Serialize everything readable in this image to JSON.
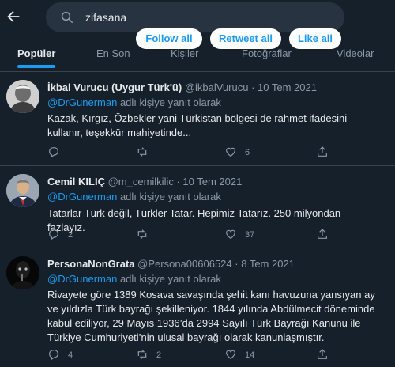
{
  "search": {
    "query": "zifasana"
  },
  "bulk_actions": {
    "follow_all": "Follow all",
    "retweet_all": "Retweet all",
    "like_all": "Like all"
  },
  "tabs": [
    {
      "label": "Popüler"
    },
    {
      "label": "En Son"
    },
    {
      "label": "Kişiler"
    },
    {
      "label": "Fotoğraflar"
    },
    {
      "label": "Videolar"
    }
  ],
  "tweets": [
    {
      "name": "İkbal Vurucu (Uygur Türk'ü)",
      "handle": "@ikbalVurucu",
      "date": "· 10 Tem 2021",
      "reply_mention": "@DrGunerman",
      "reply_suffix": " adlı kişiye yanıt olarak",
      "text": "Kazak, Kırgız, Özbekler yani Türkistan bölgesi de rahmet ifadesini kullanır, teşekkür mahiyetinde...",
      "replies": "",
      "retweets": "",
      "likes": "6"
    },
    {
      "name": "Cemil KILIÇ",
      "handle": "@m_cemilkilic",
      "date": "· 10 Tem 2021",
      "reply_mention": "@DrGunerman",
      "reply_suffix": " adlı kişiye yanıt olarak",
      "text": "Tatarlar Türk değil, Türkler Tatar. Hepimiz Tatarız. 250 milyondan fazlayız.",
      "replies": "2",
      "retweets": "",
      "likes": "37"
    },
    {
      "name": "PersonaNonGrata",
      "handle": "@Persona00606524",
      "date": "· 8 Tem 2021",
      "reply_mention": "@DrGunerman",
      "reply_suffix": " adlı kişiye yanıt olarak",
      "text": "Rivayete göre 1389 Kosava savaşında şehit kanı havuzuna yansıyan ay ve yıldızla Türk bayrağı şekilleniyor. 1844 yılında Abdülmecit döneminde kabul ediliyor, 29 Mayıs 1936’da 2994 Sayılı Türk Bayrağı Kanunu ile Türkiye Cumhuriyeti’nin ulusal bayrağı olarak kanunlaşmıştır.",
      "replies": "4",
      "retweets": "2",
      "likes": "14"
    }
  ]
}
